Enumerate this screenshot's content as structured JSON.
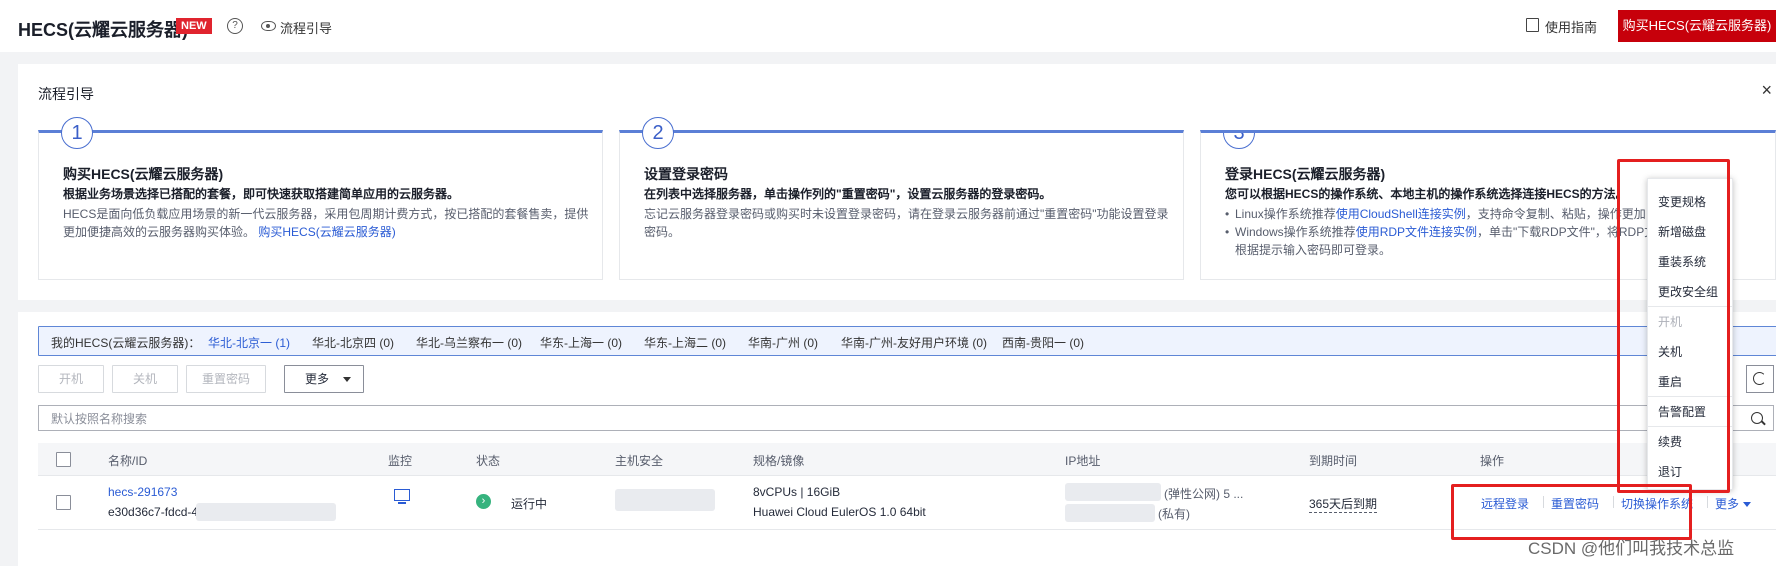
{
  "header": {
    "title": "HECS(云耀云服务器)",
    "badge": "NEW",
    "help_symbol": "?",
    "flow_guide": "流程引导",
    "user_guide": "使用指南",
    "buy_button": "购买HECS(云耀云服务器)"
  },
  "guide": {
    "title": "流程引导",
    "close": "×",
    "steps": [
      {
        "num": "1",
        "title": "购买HECS(云耀云服务器)",
        "subtitle": "根据业务场景选择已搭配的套餐，即可快速获取搭建简单应用的云服务器。",
        "desc": "HECS是面向低负载应用场景的新一代云服务器，采用包周期计费方式，按已搭配的套餐售卖，提供更加便捷高效的云服务器购买体验。",
        "link": "购买HECS(云耀云服务器)"
      },
      {
        "num": "2",
        "title": "设置登录密码",
        "subtitle": "在列表中选择服务器，单击操作列的\"重置密码\"，设置云服务器的登录密码。",
        "desc": "忘记云服务器登录密码或购买时未设置登录密码，请在登录云服务器前通过\"重置密码\"功能设置登录密码。"
      },
      {
        "num": "3",
        "title": "登录HECS(云耀云服务器)",
        "subtitle": "您可以根据HECS的操作系统、本地主机的操作系统选择连接HECS的方法。",
        "b1_pre": "Linux操作系统推荐",
        "b1_link": "使用CloudShell连接实例",
        "b1_post": "，支持命令复制、粘贴，操作更加",
        "b2_pre": "Windows操作系统推荐",
        "b2_link": "使用RDP文件连接实例",
        "b2_post": "，单击\"下载RDP文件\"，将RDP文",
        "b2_cont": "根据提示输入密码即可登录。"
      }
    ]
  },
  "regions": {
    "label": "我的HECS(云耀云服务器)：",
    "items": [
      {
        "name": "华北-北京一",
        "count": "(1)"
      },
      {
        "name": "华北-北京四",
        "count": "(0)"
      },
      {
        "name": "华北-乌兰察布一",
        "count": "(0)"
      },
      {
        "name": "华东-上海一",
        "count": "(0)"
      },
      {
        "name": "华东-上海二",
        "count": "(0)"
      },
      {
        "name": "华南-广州",
        "count": "(0)"
      },
      {
        "name": "华南-广州-友好用户环境",
        "count": "(0)"
      },
      {
        "name": "西南-贵阳一",
        "count": "(0)"
      }
    ]
  },
  "toolbar": {
    "start": "开机",
    "stop": "关机",
    "reset_pwd": "重置密码",
    "more": "更多"
  },
  "search": {
    "placeholder": "默认按照名称搜索"
  },
  "table": {
    "headers": [
      "名称/ID",
      "监控",
      "状态",
      "主机安全",
      "规格/镜像",
      "IP地址",
      "到期时间",
      "操作"
    ],
    "row": {
      "name": "hecs-291673",
      "id": "e30d36c7-fdcd-4",
      "status": "运行中",
      "spec": "8vCPUs | 16GiB",
      "image": "Huawei Cloud EulerOS 1.0 64bit",
      "ip_public": "(弹性公网)  5 ...",
      "ip_private": "(私有)",
      "expiry": "365天后到期",
      "ops": [
        "远程登录",
        "重置密码",
        "切换操作系统",
        "更多"
      ]
    }
  },
  "more_menu": {
    "items": [
      "变更规格",
      "新增磁盘",
      "重装系统",
      "更改安全组",
      "开机",
      "关机",
      "重启",
      "告警配置",
      "续费",
      "退订"
    ]
  },
  "watermark": "CSDN @他们叫我技术总监"
}
